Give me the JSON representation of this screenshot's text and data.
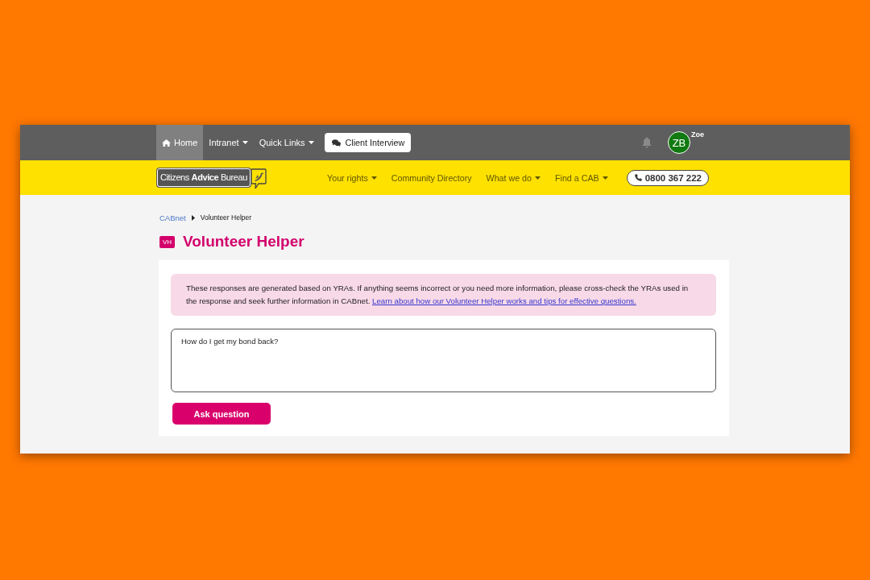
{
  "top_bar": {
    "nav": [
      {
        "label": "Home",
        "kind": "home",
        "selected": true
      },
      {
        "label": "Intranet",
        "kind": "dropdown",
        "selected": false
      },
      {
        "label": "Quick Links",
        "kind": "dropdown",
        "selected": false
      }
    ],
    "client_interview_button": {
      "label": "Client Interview"
    },
    "user": {
      "initials": "ZB",
      "name": "Zoe"
    }
  },
  "brand_bar": {
    "logo": "Citizens **Advice** Bureau",
    "nav": [
      {
        "label": "Your rights",
        "kind": "dropdown"
      },
      {
        "label": "Community Directory",
        "kind": "link"
      },
      {
        "label": "What we do",
        "kind": "dropdown"
      },
      {
        "label": "Find a CAB",
        "kind": "dropdown"
      }
    ],
    "phone": "0800 367 222"
  },
  "breadcrumb": [
    {
      "label": "CABnet",
      "kind": "link"
    },
    {
      "label": "Volunteer Helper",
      "kind": "current"
    }
  ],
  "page_title": {
    "badge": "VH",
    "text": "Volunteer Helper"
  },
  "notice": {
    "text": "These responses are generated based on YRAs. If anything seems incorrect or you need more information, please cross-check the YRAs used in the response and seek further information in CABnet.",
    "link": "Learn about how our Volunteer Helper works and tips for effective questions."
  },
  "question_field": {
    "value": "How do I get my bond back?"
  },
  "ask_button": {
    "label": "Ask question"
  }
}
